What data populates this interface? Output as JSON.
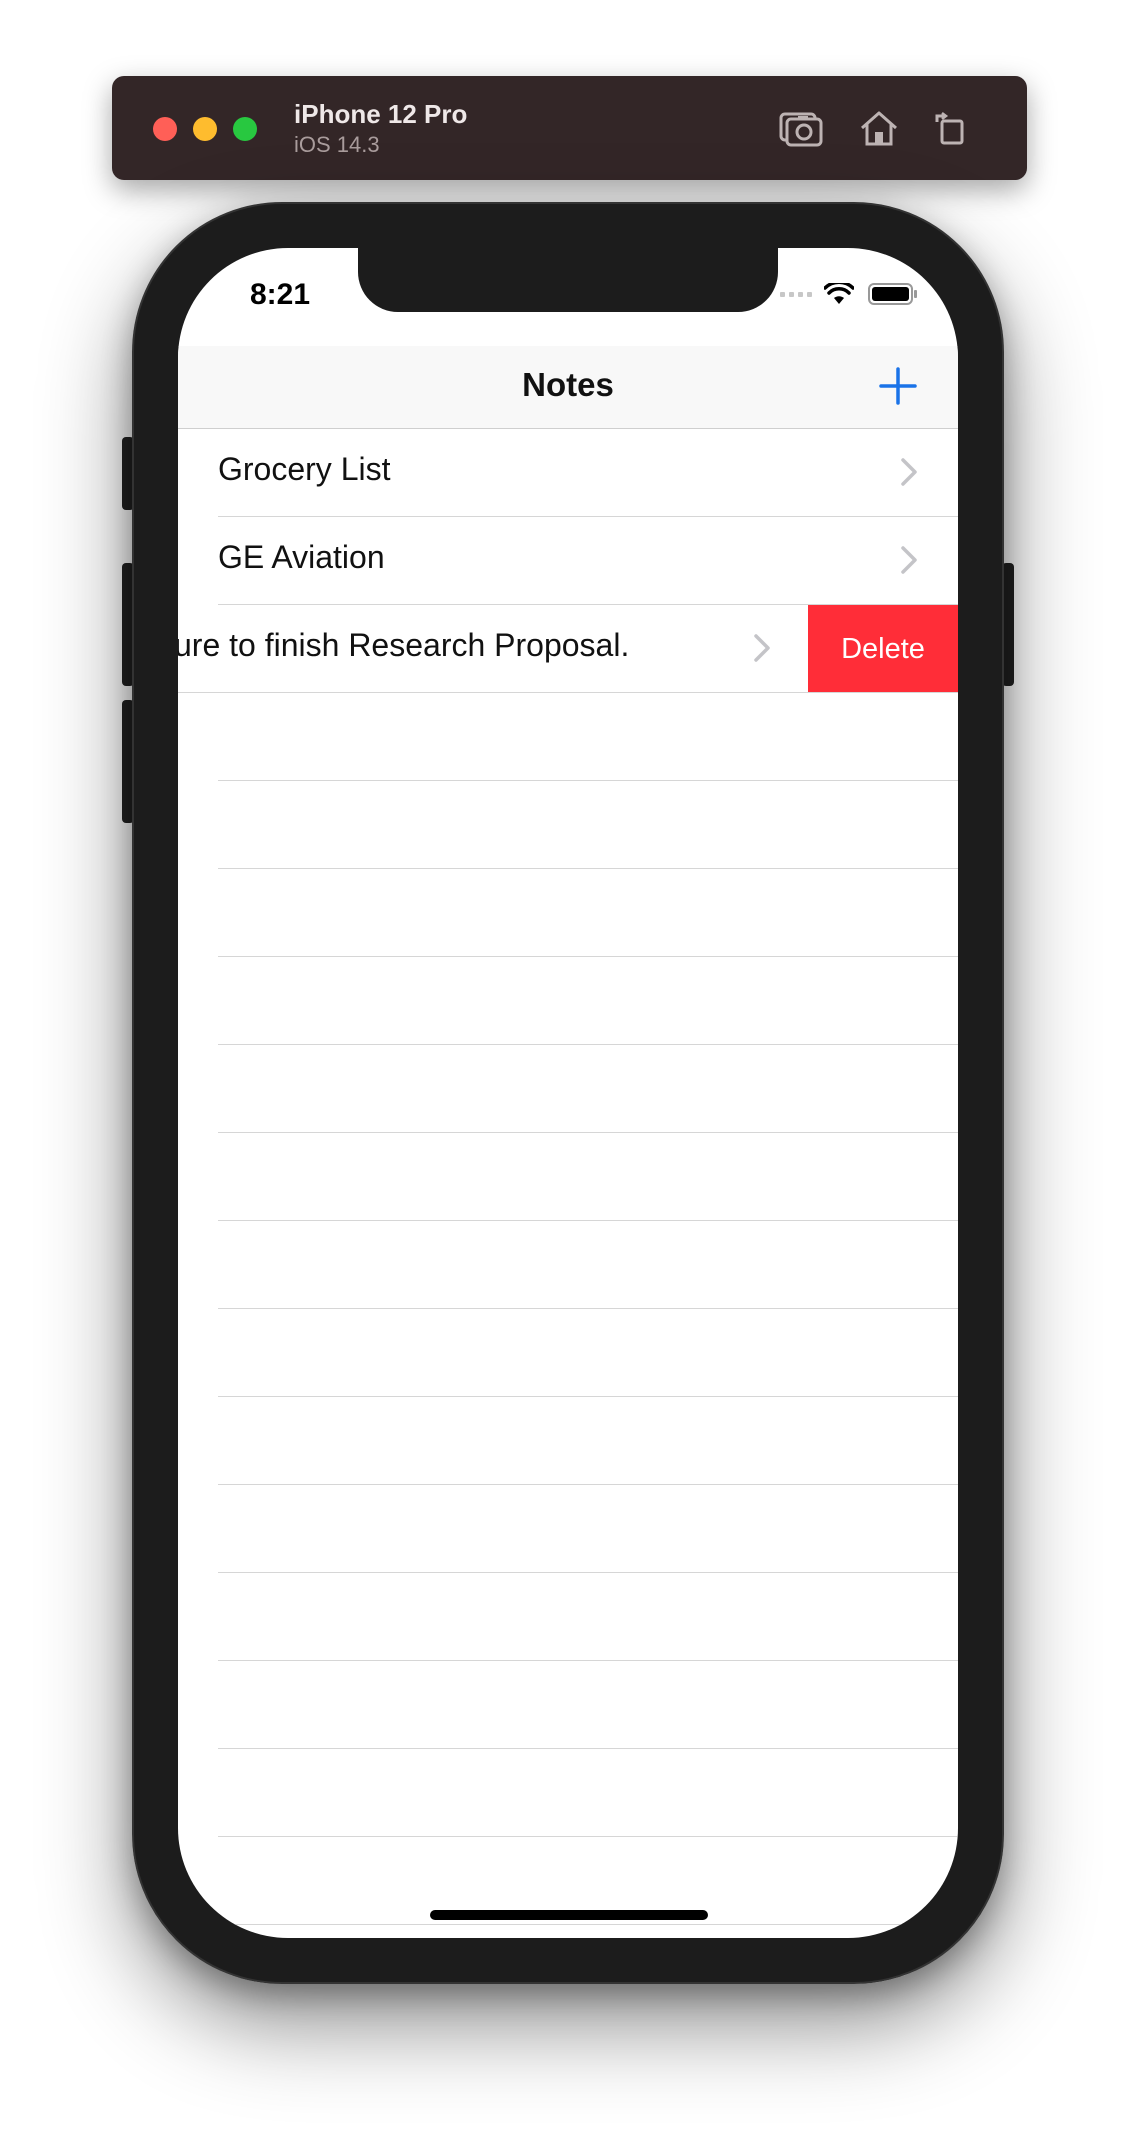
{
  "simulator": {
    "device_name": "iPhone 12 Pro",
    "os_version": "iOS 14.3",
    "buttons": [
      "screenshot-icon",
      "home-icon",
      "rotate-icon"
    ]
  },
  "status_bar": {
    "time": "8:21",
    "icons": [
      "cellular-icon",
      "wifi-icon",
      "battery-icon"
    ]
  },
  "nav": {
    "title": "Notes",
    "add_icon": "plus-icon",
    "accent_color": "#1a73e8"
  },
  "notes": [
    {
      "title": "Grocery List"
    },
    {
      "title": "GE Aviation"
    },
    {
      "title": "ure to finish Research Proposal.",
      "swiped": true,
      "action_label": "Delete",
      "action_color": "#ff2d38"
    }
  ]
}
